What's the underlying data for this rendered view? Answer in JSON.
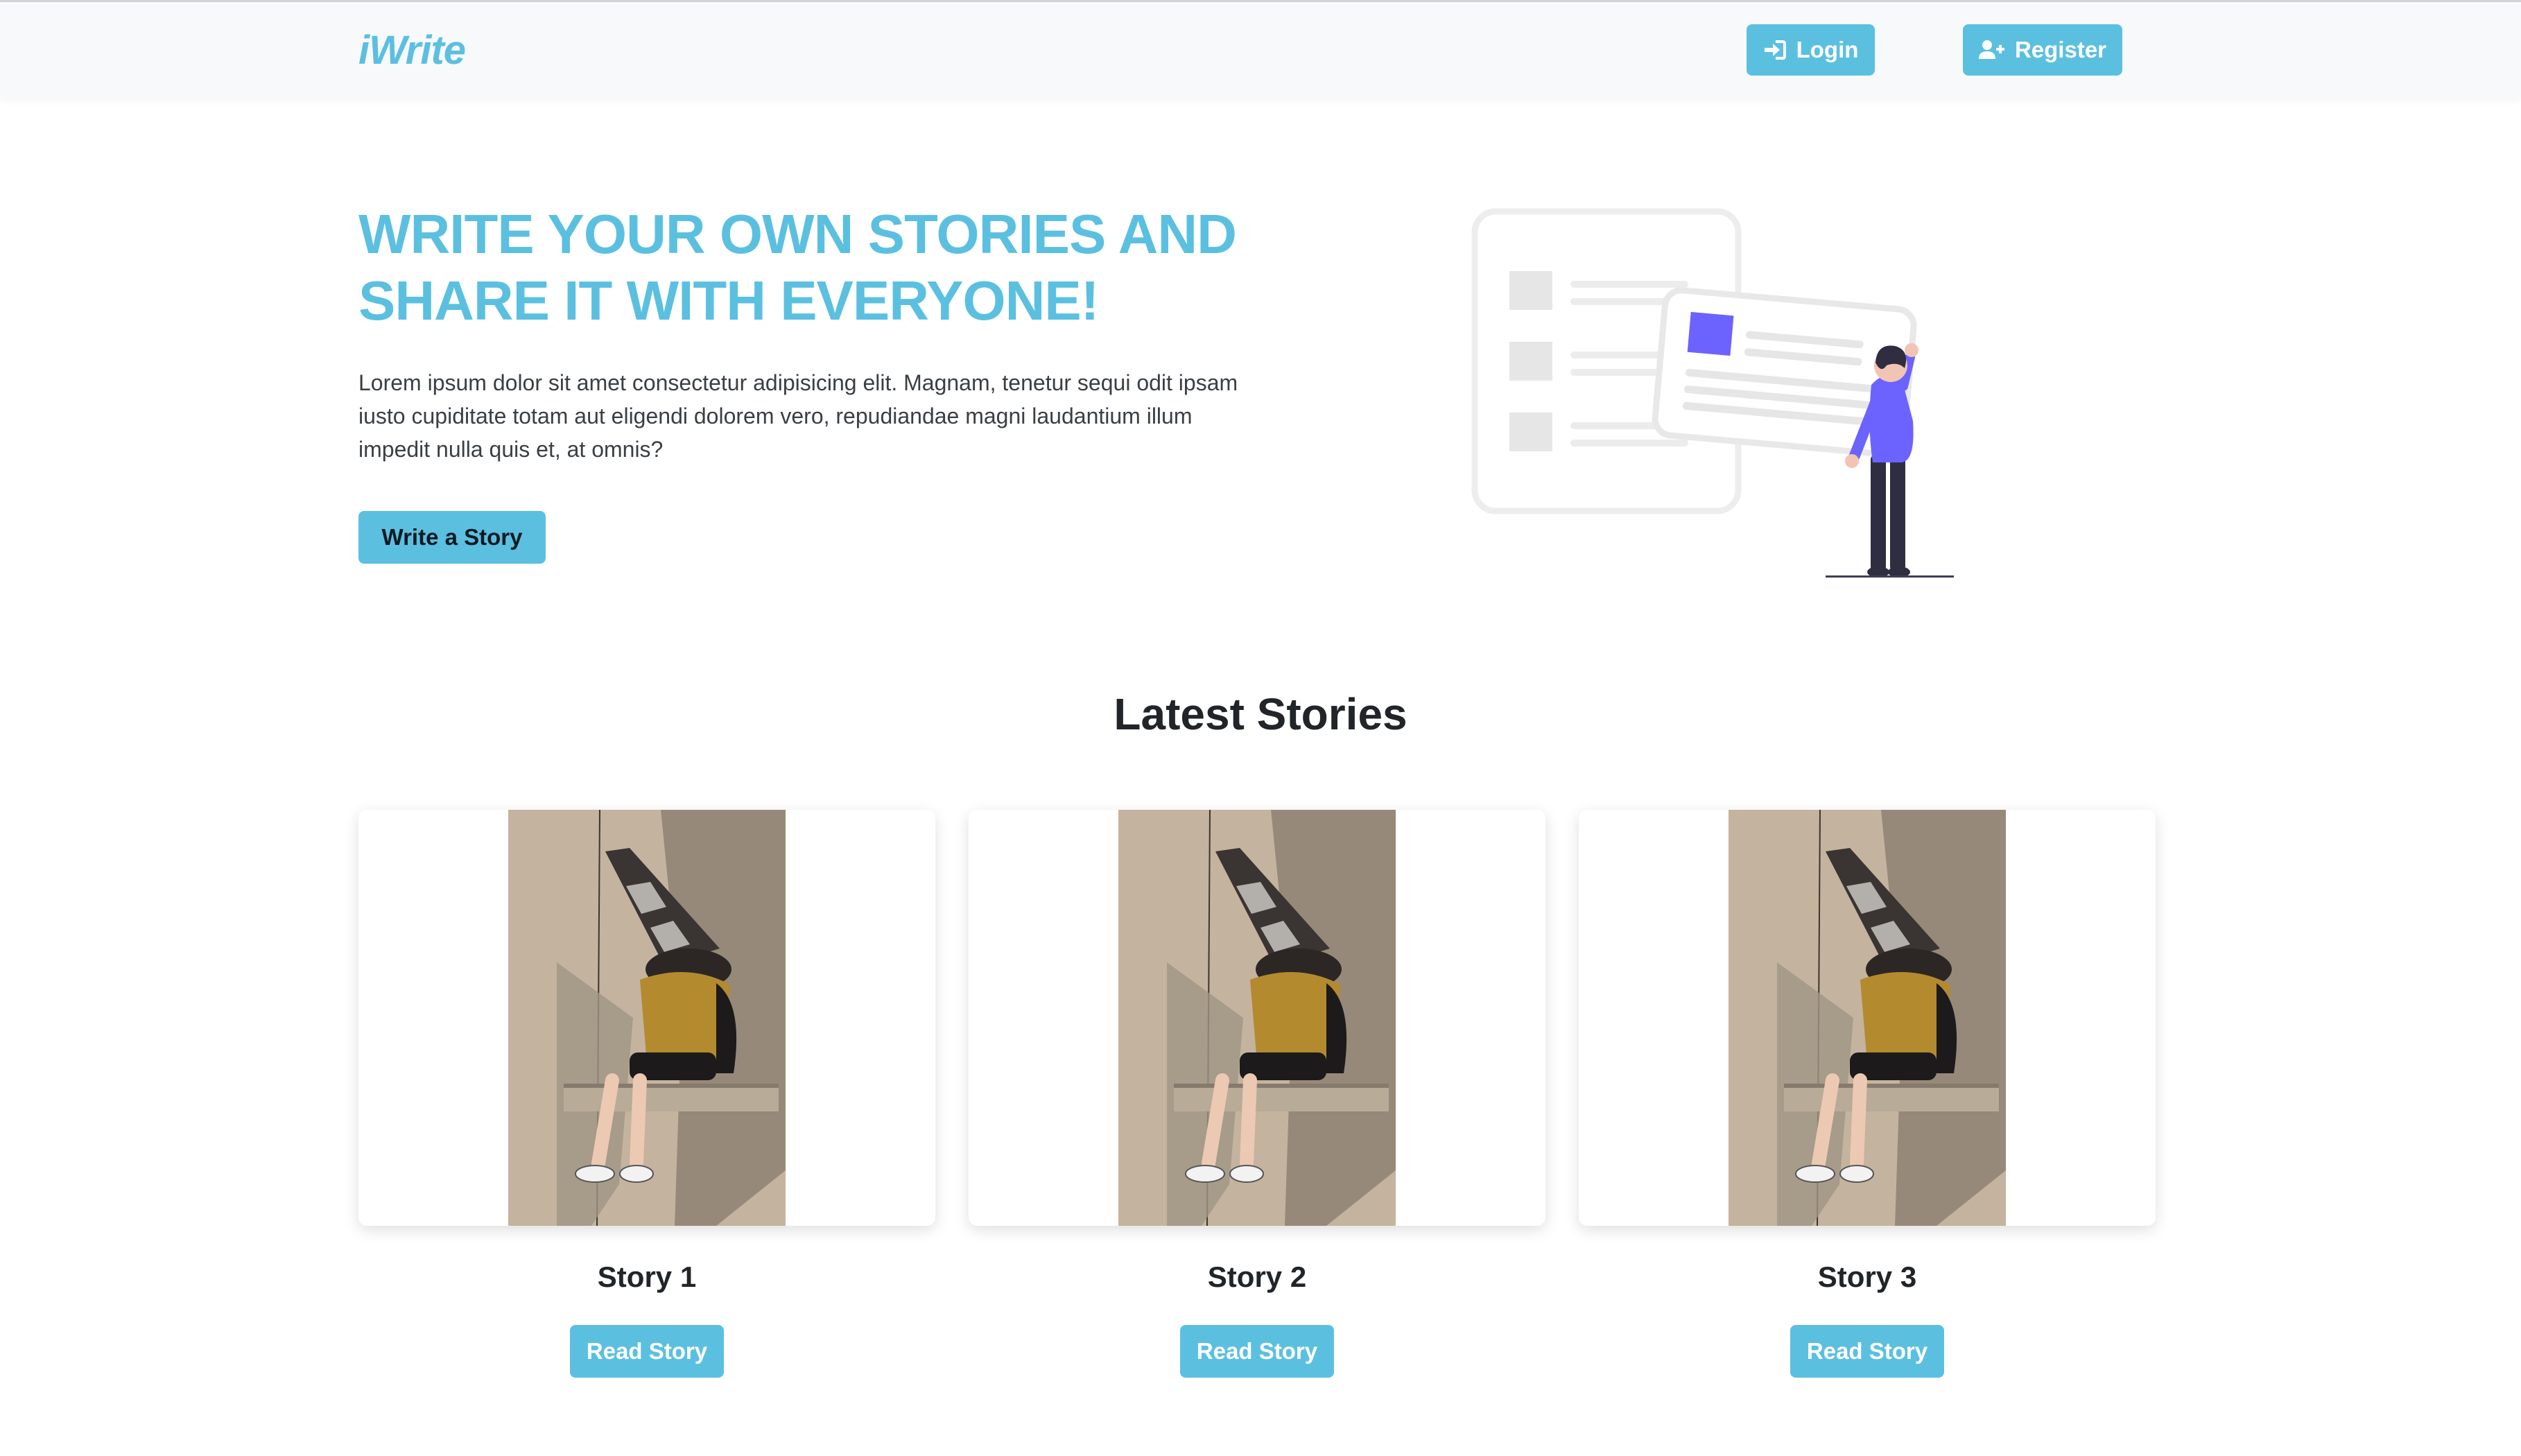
{
  "navbar": {
    "brand": "iWrite",
    "login_label": "Login",
    "register_label": "Register",
    "login_icon": "sign-in-icon",
    "register_icon": "user-plus-icon"
  },
  "hero": {
    "title_line1": "WRITE YOUR OWN STORIES AND",
    "title_line2": "SHARE IT WITH EVERYONE!",
    "description": "Lorem ipsum dolor sit amet consectetur adipisicing elit. Magnam, tenetur sequi odit ipsam iusto cupiditate totam aut eligendi dolorem vero, repudiandae magni laudantium illum impedit nulla quis et, at omnis?",
    "cta_label": "Write a Story"
  },
  "latest": {
    "title": "Latest Stories",
    "stories": [
      {
        "title": "Story 1",
        "button_label": "Read Story"
      },
      {
        "title": "Story 2",
        "button_label": "Read Story"
      },
      {
        "title": "Story 3",
        "button_label": "Read Story"
      }
    ]
  },
  "colors": {
    "accent": "#5bc0e0",
    "navbar_bg": "#f8f9fa",
    "illustration_accent": "#6c63ff",
    "text_dark": "#212529"
  }
}
